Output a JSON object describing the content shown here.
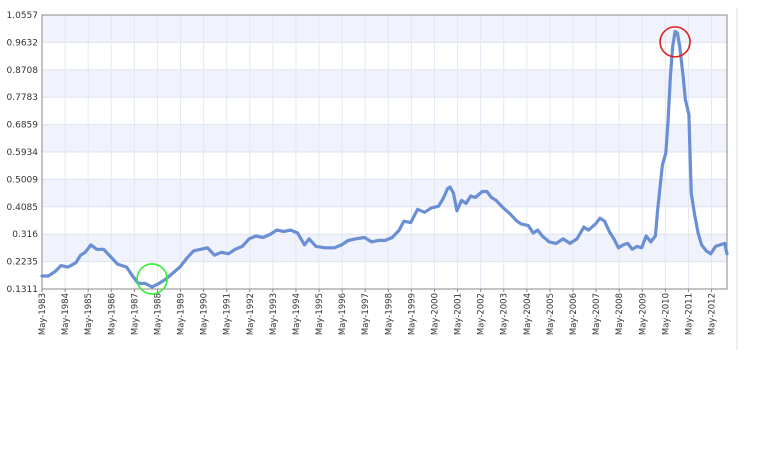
{
  "chart_data": {
    "type": "line",
    "title": "",
    "xlabel": "",
    "ylabel": "",
    "ylim": [
      0.1311,
      1.0557
    ],
    "y_ticks": [
      "1.0557",
      "0.9632",
      "0.8708",
      "0.7783",
      "0.6859",
      "0.5934",
      "0.5009",
      "0.4085",
      "0.316",
      "0.2235",
      "0.1311"
    ],
    "x_ticks": [
      "May-1983",
      "May-1984",
      "May-1985",
      "May-1986",
      "May-1987",
      "May-1988",
      "May-1989",
      "May-1990",
      "May-1991",
      "May-1992",
      "May-1993",
      "May-1994",
      "May-1995",
      "May-1996",
      "May-1997",
      "May-1998",
      "May-1999",
      "May-2000",
      "May-2001",
      "May-2002",
      "May-2003",
      "May-2004",
      "May-2005",
      "May-2006",
      "May-2007",
      "May-2008",
      "May-2009",
      "May-2010",
      "May-2011",
      "May-2012"
    ],
    "xlim": [
      1983.33,
      2013.0
    ],
    "grid": true,
    "line_color": "#6b8fd4",
    "series": [
      {
        "points": [
          [
            1983.33,
            0.175
          ],
          [
            1983.6,
            0.175
          ],
          [
            1983.9,
            0.19
          ],
          [
            1984.15,
            0.21
          ],
          [
            1984.45,
            0.205
          ],
          [
            1984.8,
            0.22
          ],
          [
            1985.0,
            0.245
          ],
          [
            1985.2,
            0.255
          ],
          [
            1985.45,
            0.28
          ],
          [
            1985.7,
            0.265
          ],
          [
            1986.0,
            0.265
          ],
          [
            1986.3,
            0.24
          ],
          [
            1986.6,
            0.215
          ],
          [
            1987.0,
            0.205
          ],
          [
            1987.25,
            0.175
          ],
          [
            1987.5,
            0.15
          ],
          [
            1987.8,
            0.15
          ],
          [
            1988.1,
            0.138
          ],
          [
            1988.4,
            0.15
          ],
          [
            1988.7,
            0.165
          ],
          [
            1989.0,
            0.185
          ],
          [
            1989.3,
            0.205
          ],
          [
            1989.6,
            0.235
          ],
          [
            1989.9,
            0.26
          ],
          [
            1990.2,
            0.265
          ],
          [
            1990.5,
            0.27
          ],
          [
            1990.8,
            0.245
          ],
          [
            1991.1,
            0.255
          ],
          [
            1991.4,
            0.25
          ],
          [
            1991.7,
            0.265
          ],
          [
            1992.0,
            0.275
          ],
          [
            1992.3,
            0.3
          ],
          [
            1992.6,
            0.31
          ],
          [
            1992.9,
            0.305
          ],
          [
            1993.2,
            0.315
          ],
          [
            1993.5,
            0.33
          ],
          [
            1993.8,
            0.325
          ],
          [
            1994.1,
            0.33
          ],
          [
            1994.4,
            0.32
          ],
          [
            1994.7,
            0.28
          ],
          [
            1994.9,
            0.3
          ],
          [
            1995.2,
            0.275
          ],
          [
            1995.6,
            0.27
          ],
          [
            1996.0,
            0.27
          ],
          [
            1996.3,
            0.28
          ],
          [
            1996.6,
            0.295
          ],
          [
            1996.9,
            0.3
          ],
          [
            1997.3,
            0.305
          ],
          [
            1997.6,
            0.29
          ],
          [
            1997.9,
            0.295
          ],
          [
            1998.2,
            0.295
          ],
          [
            1998.5,
            0.305
          ],
          [
            1998.8,
            0.33
          ],
          [
            1999.0,
            0.36
          ],
          [
            1999.3,
            0.355
          ],
          [
            1999.6,
            0.4
          ],
          [
            1999.9,
            0.39
          ],
          [
            2000.2,
            0.405
          ],
          [
            2000.5,
            0.41
          ],
          [
            2000.7,
            0.435
          ],
          [
            2000.9,
            0.47
          ],
          [
            2001.0,
            0.475
          ],
          [
            2001.15,
            0.455
          ],
          [
            2001.3,
            0.395
          ],
          [
            2001.5,
            0.43
          ],
          [
            2001.7,
            0.42
          ],
          [
            2001.9,
            0.445
          ],
          [
            2002.1,
            0.44
          ],
          [
            2002.4,
            0.46
          ],
          [
            2002.6,
            0.46
          ],
          [
            2002.8,
            0.44
          ],
          [
            2003.0,
            0.43
          ],
          [
            2003.3,
            0.405
          ],
          [
            2003.6,
            0.385
          ],
          [
            2003.9,
            0.36
          ],
          [
            2004.1,
            0.35
          ],
          [
            2004.4,
            0.345
          ],
          [
            2004.6,
            0.32
          ],
          [
            2004.8,
            0.33
          ],
          [
            2005.0,
            0.31
          ],
          [
            2005.3,
            0.29
          ],
          [
            2005.6,
            0.285
          ],
          [
            2005.9,
            0.3
          ],
          [
            2006.2,
            0.285
          ],
          [
            2006.5,
            0.3
          ],
          [
            2006.8,
            0.34
          ],
          [
            2007.0,
            0.33
          ],
          [
            2007.3,
            0.35
          ],
          [
            2007.5,
            0.37
          ],
          [
            2007.7,
            0.36
          ],
          [
            2007.9,
            0.325
          ],
          [
            2008.1,
            0.3
          ],
          [
            2008.3,
            0.27
          ],
          [
            2008.5,
            0.28
          ],
          [
            2008.7,
            0.285
          ],
          [
            2008.9,
            0.265
          ],
          [
            2009.1,
            0.275
          ],
          [
            2009.3,
            0.27
          ],
          [
            2009.5,
            0.31
          ],
          [
            2009.7,
            0.29
          ],
          [
            2009.9,
            0.31
          ],
          [
            2010.0,
            0.4
          ],
          [
            2010.2,
            0.55
          ],
          [
            2010.35,
            0.59
          ],
          [
            2010.45,
            0.7
          ],
          [
            2010.55,
            0.85
          ],
          [
            2010.65,
            0.95
          ],
          [
            2010.75,
            1.0
          ],
          [
            2010.85,
            0.995
          ],
          [
            2010.95,
            0.95
          ],
          [
            2011.1,
            0.85
          ],
          [
            2011.2,
            0.77
          ],
          [
            2011.35,
            0.72
          ],
          [
            2011.45,
            0.455
          ],
          [
            2011.6,
            0.38
          ],
          [
            2011.75,
            0.32
          ],
          [
            2011.9,
            0.28
          ],
          [
            2012.1,
            0.26
          ],
          [
            2012.3,
            0.25
          ],
          [
            2012.5,
            0.275
          ],
          [
            2012.7,
            0.28
          ],
          [
            2012.9,
            0.285
          ],
          [
            2013.0,
            0.25
          ]
        ]
      }
    ]
  },
  "annotations": [
    {
      "label": "low-highlight",
      "x": 1988.1,
      "y": 0.165,
      "color": "#33ee33"
    },
    {
      "label": "peak-highlight",
      "x": 2010.75,
      "y": 0.965,
      "color": "#e02020"
    }
  ]
}
